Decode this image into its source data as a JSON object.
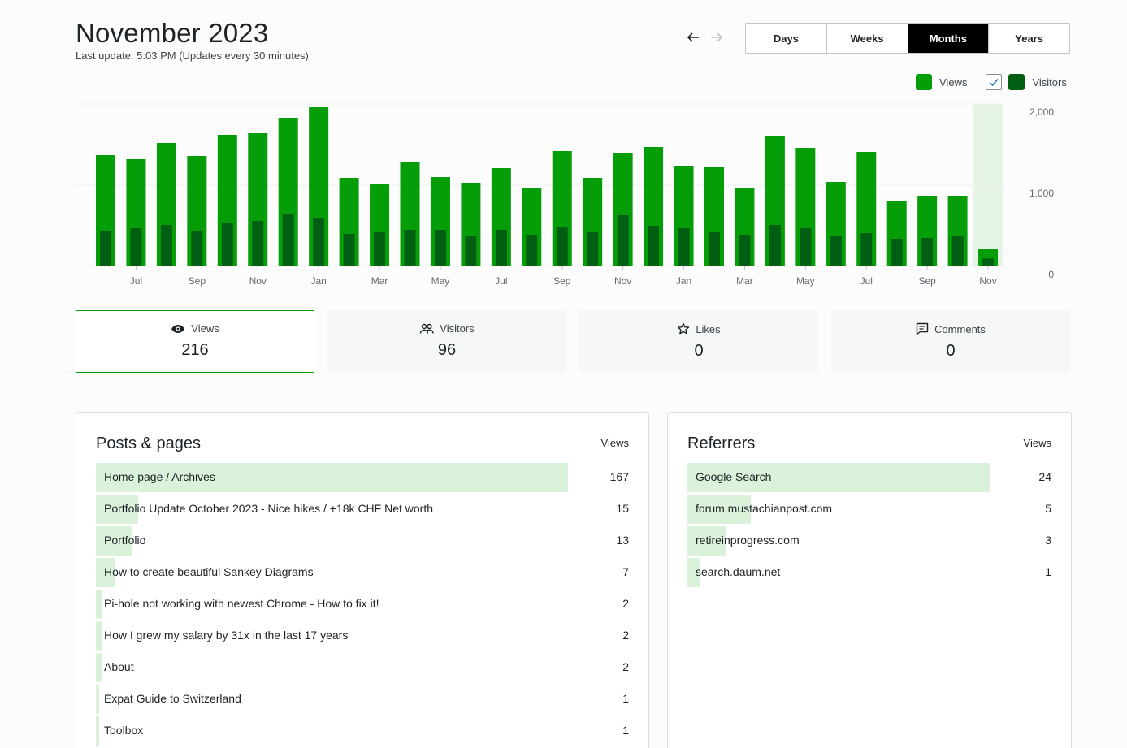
{
  "header": {
    "title": "November 2023",
    "subtitle": "Last update: 5:03 PM (Updates every 30 minutes)"
  },
  "nav": {
    "prev_icon": "arrow-left-icon",
    "next_icon": "arrow-right-icon"
  },
  "period_tabs": [
    {
      "label": "Days",
      "selected": false
    },
    {
      "label": "Weeks",
      "selected": false
    },
    {
      "label": "Months",
      "selected": true
    },
    {
      "label": "Years",
      "selected": false
    }
  ],
  "legend": {
    "views_label": "Views",
    "visitors_label": "Visitors",
    "visitors_checked": true
  },
  "colors": {
    "views": "#069e08",
    "visitors": "#005f12",
    "highlight": "#e6f4e6",
    "selected_border": "#069e08",
    "row_bar": "#daf1da"
  },
  "chart_data": {
    "type": "bar",
    "categories": [
      "Jun",
      "Jul",
      "Aug",
      "Sep",
      "Oct",
      "Nov",
      "Dec",
      "Jan",
      "Feb",
      "Mar",
      "Apr",
      "May",
      "Jun",
      "Jul",
      "Aug",
      "Sep",
      "Oct",
      "Nov",
      "Dec",
      "Jan",
      "Feb",
      "Mar",
      "Apr",
      "May",
      "Jun",
      "Jul",
      "Aug",
      "Sep",
      "Oct",
      "Nov"
    ],
    "x_tick_labels": [
      "Jul",
      "Sep",
      "Nov",
      "Jan",
      "Mar",
      "May",
      "Jul",
      "Sep",
      "Nov",
      "Jan",
      "Mar",
      "May",
      "Jul",
      "Sep",
      "Nov"
    ],
    "x_tick_indices": [
      1,
      3,
      5,
      7,
      9,
      11,
      13,
      15,
      17,
      19,
      21,
      23,
      25,
      27,
      29
    ],
    "series": [
      {
        "name": "Views",
        "values": [
          1370,
          1320,
          1520,
          1360,
          1620,
          1640,
          1830,
          1960,
          1090,
          1010,
          1290,
          1100,
          1030,
          1210,
          970,
          1420,
          1090,
          1390,
          1470,
          1230,
          1220,
          960,
          1610,
          1460,
          1040,
          1410,
          810,
          870,
          870,
          216
        ]
      },
      {
        "name": "Visitors",
        "values": [
          440,
          470,
          510,
          440,
          540,
          560,
          650,
          590,
          400,
          420,
          450,
          450,
          370,
          450,
          390,
          480,
          420,
          630,
          500,
          470,
          420,
          390,
          510,
          470,
          370,
          410,
          340,
          350,
          380,
          96
        ]
      }
    ],
    "y_ticks": [
      "2,000",
      "1,000",
      "0"
    ],
    "ylim": [
      0,
      2000
    ],
    "highlight_index": 29,
    "grid": true
  },
  "stats": [
    {
      "label": "Views",
      "value": "216",
      "icon": "eye-icon",
      "selected": true
    },
    {
      "label": "Visitors",
      "value": "96",
      "icon": "people-icon",
      "selected": false
    },
    {
      "label": "Likes",
      "value": "0",
      "icon": "star-icon",
      "selected": false
    },
    {
      "label": "Comments",
      "value": "0",
      "icon": "comment-icon",
      "selected": false
    }
  ],
  "posts": {
    "title": "Posts & pages",
    "column": "Views",
    "rows": [
      {
        "label": "Home page / Archives",
        "value": "167",
        "share": 1.0
      },
      {
        "label": "Portfolio Update October 2023 - Nice hikes / +18k CHF Net worth",
        "value": "15",
        "share": 0.09
      },
      {
        "label": "Portfolio",
        "value": "13",
        "share": 0.078
      },
      {
        "label": "How to create beautiful Sankey Diagrams",
        "value": "7",
        "share": 0.042
      },
      {
        "label": "Pi-hole not working with newest Chrome - How to fix it!",
        "value": "2",
        "share": 0.012
      },
      {
        "label": "How I grew my salary by 31x in the last 17 years",
        "value": "2",
        "share": 0.012
      },
      {
        "label": "About",
        "value": "2",
        "share": 0.012
      },
      {
        "label": "Expat Guide to Switzerland",
        "value": "1",
        "share": 0.006
      },
      {
        "label": "Toolbox",
        "value": "1",
        "share": 0.006
      }
    ]
  },
  "referrers": {
    "title": "Referrers",
    "column": "Views",
    "rows": [
      {
        "label": "Google Search",
        "value": "24",
        "share": 1.0
      },
      {
        "label": "forum.mustachianpost.com",
        "value": "5",
        "share": 0.21
      },
      {
        "label": "retireinprogress.com",
        "value": "3",
        "share": 0.125
      },
      {
        "label": "search.daum.net",
        "value": "1",
        "share": 0.042
      }
    ]
  }
}
